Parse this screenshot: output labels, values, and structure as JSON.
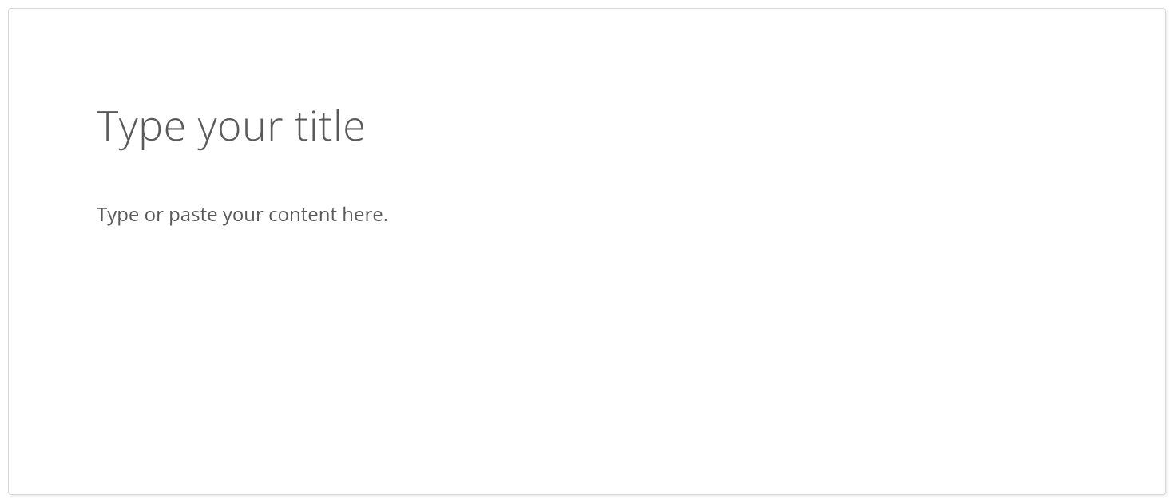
{
  "editor": {
    "title_placeholder": "Type your title",
    "title_value": "",
    "content_placeholder": "Type or paste your content here.",
    "content_value": ""
  }
}
